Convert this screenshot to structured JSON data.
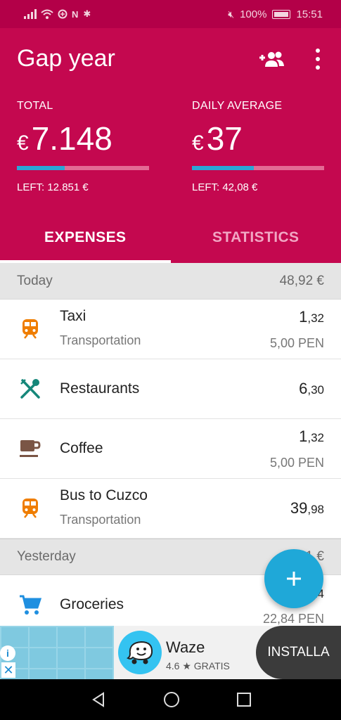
{
  "status_bar": {
    "left_icons": [
      "signal-icon",
      "wifi-icon",
      "data-saver-icon",
      "nfc-icon",
      "bluetooth-icon"
    ],
    "battery_percent": "100%",
    "time": "15:51"
  },
  "header": {
    "title": "Gap year",
    "total": {
      "label": "TOTAL",
      "currency": "€",
      "value": "7.148",
      "left": "LEFT: 12.851 €",
      "progress": 0.36
    },
    "daily": {
      "label": "DAILY AVERAGE",
      "currency": "€",
      "value": "37",
      "left": "LEFT: 42,08 €",
      "progress": 0.47
    }
  },
  "tabs": [
    {
      "label": "EXPENSES",
      "active": true
    },
    {
      "label": "STATISTICS",
      "active": false
    }
  ],
  "sections": [
    {
      "label": "Today",
      "total": "48,92 €",
      "rows": [
        {
          "icon": "train-icon",
          "name": "Taxi",
          "category": "Transportation",
          "int": "1",
          "dec": ",32",
          "orig": "5,00 PEN"
        },
        {
          "icon": "restaurant-icon",
          "name": "Restaurants",
          "category": "",
          "int": "6",
          "dec": ",30",
          "orig": ""
        },
        {
          "icon": "coffee-icon",
          "name": "Coffee",
          "category": "",
          "int": "1",
          "dec": ",32",
          "orig": "5,00 PEN"
        },
        {
          "icon": "train-icon",
          "name": "Bus to Cuzco",
          "category": "Transportation",
          "int": "39",
          "dec": ",98",
          "orig": ""
        }
      ]
    },
    {
      "label": "Yesterday",
      "total": "6,21 €",
      "rows": [
        {
          "icon": "cart-icon",
          "name": "Groceries",
          "category": "",
          "int": "6",
          "dec": ",24",
          "orig": "22,84 PEN"
        }
      ]
    }
  ],
  "ad": {
    "app_name": "Waze",
    "rating": "4.6 ★ GRATIS",
    "button": "INSTALLA"
  },
  "colors": {
    "primary": "#c4084f",
    "accent": "#1fa8d8",
    "transport": "#ef7d00",
    "restaurant": "#16877a",
    "coffee": "#7a5545",
    "cart": "#1f8fe0"
  }
}
